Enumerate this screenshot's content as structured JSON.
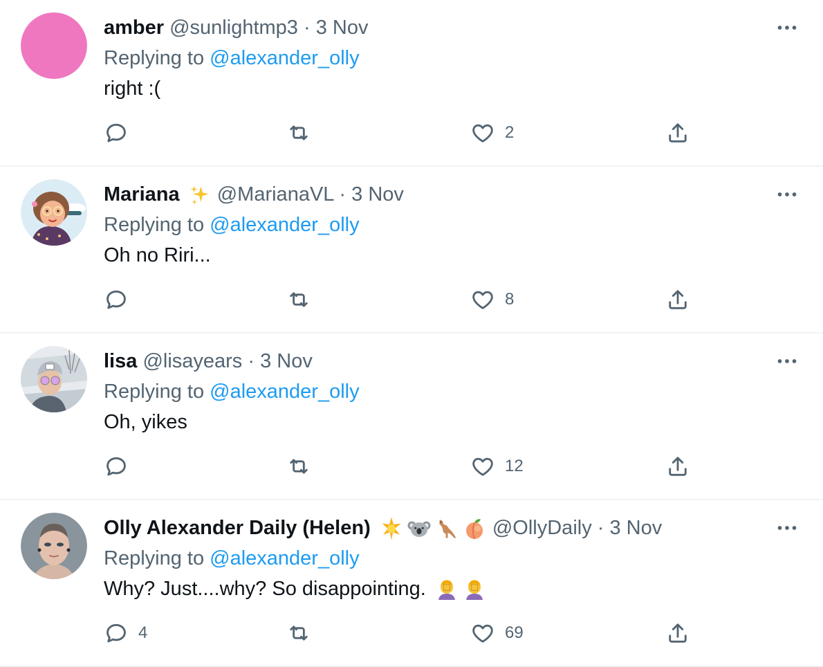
{
  "tweets": [
    {
      "name": "amber",
      "handle": "@sunlightmp3",
      "sep": "·",
      "date": "3 Nov",
      "replying_prefix": "Replying to",
      "replying_to": "@alexander_olly",
      "text": "right :(",
      "replies": "",
      "retweets": "",
      "likes": "2",
      "avatar_color": "#ef77c0"
    },
    {
      "name": "Mariana",
      "handle": "@MarianaVL",
      "sep": "·",
      "date": "3 Nov",
      "replying_prefix": "Replying to",
      "replying_to": "@alexander_olly",
      "text": "Oh no Riri...",
      "replies": "",
      "retweets": "",
      "likes": "8"
    },
    {
      "name": "lisa",
      "handle": "@lisayears",
      "sep": "·",
      "date": "3 Nov",
      "replying_prefix": "Replying to",
      "replying_to": "@alexander_olly",
      "text": "Oh, yikes",
      "replies": "",
      "retweets": "",
      "likes": "12"
    },
    {
      "name": "Olly Alexander Daily (Helen)",
      "handle": "@OllyDaily",
      "sep": "·",
      "date": "3 Nov",
      "replying_prefix": "Replying to",
      "replying_to": "@alexander_olly",
      "text": "Why? Just....why? So disappointing.",
      "replies": "4",
      "retweets": "",
      "likes": "69"
    }
  ],
  "colors": {
    "accent": "#1d9bf0",
    "muted": "#536471",
    "divider": "#eff3f4"
  }
}
